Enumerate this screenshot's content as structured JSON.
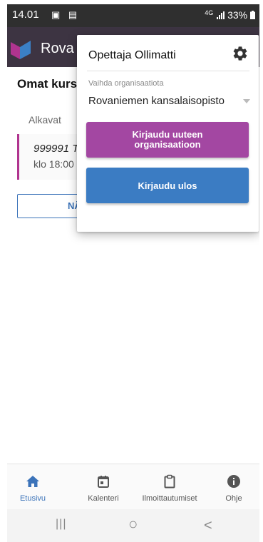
{
  "status_bar": {
    "time": "14.01",
    "icons_left": "▣ ▤",
    "network": "4G",
    "battery": "33%"
  },
  "app_bar": {
    "title": "Rova"
  },
  "main": {
    "heading": "Omat kurs",
    "tab_label": "Alkavat",
    "card": {
      "code": "999991 T",
      "time": "klo 18:00"
    },
    "show_button_label": "NÄ"
  },
  "user_menu": {
    "username": "Opettaja Ollimatti",
    "org_label": "Vaihda organisaatiota",
    "org_value": "Rovaniemen kansalaisopisto",
    "login_button": "Kirjaudu uuteen organisaatioon",
    "logout_button": "Kirjaudu ulos"
  },
  "bottom_nav": {
    "items": [
      {
        "label": "Etusivu",
        "icon": "home-icon",
        "active": true
      },
      {
        "label": "Kalenteri",
        "icon": "calendar-icon",
        "active": false
      },
      {
        "label": "Ilmoittautumiset",
        "icon": "clipboard-icon",
        "active": false
      },
      {
        "label": "Ohje",
        "icon": "info-icon",
        "active": false
      }
    ]
  },
  "system_nav": {
    "recents": "|||",
    "home": "○",
    "back": "<"
  },
  "colors": {
    "appbar": "#3d3442",
    "purple_button": "#a347a2",
    "blue_button": "#3b7cc3",
    "accent": "#3b73b9"
  }
}
